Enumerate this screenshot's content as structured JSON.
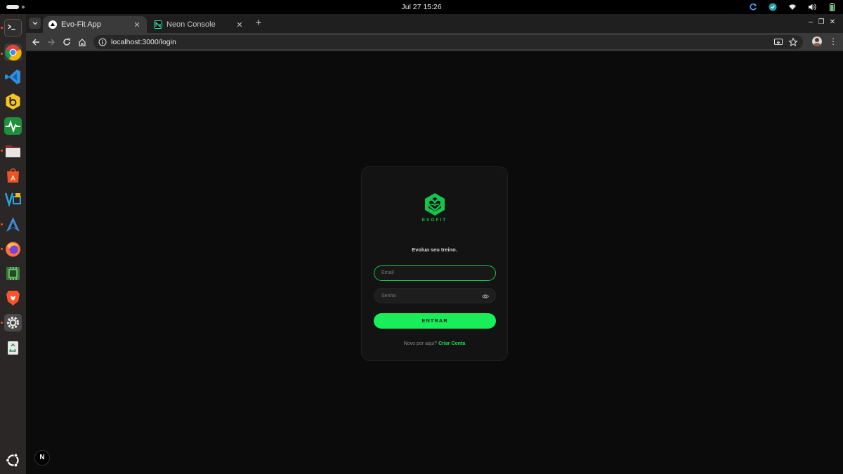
{
  "system": {
    "clock": "Jul 27  15:26"
  },
  "dock": {
    "apps": [
      {
        "name": "terminal",
        "indicator": true
      },
      {
        "name": "chrome",
        "indicator": true
      },
      {
        "name": "vscode",
        "indicator": false
      },
      {
        "name": "beekeeper",
        "indicator": false
      },
      {
        "name": "system-monitor",
        "indicator": false
      },
      {
        "name": "files",
        "indicator": true
      },
      {
        "name": "app-center",
        "indicator": false
      },
      {
        "name": "virtualbox",
        "indicator": false
      },
      {
        "name": "arch-app",
        "indicator": true
      },
      {
        "name": "firefox",
        "indicator": true
      },
      {
        "name": "chip-app",
        "indicator": false
      },
      {
        "name": "brave",
        "indicator": false
      },
      {
        "name": "settings",
        "indicator": true
      },
      {
        "name": "trash",
        "indicator": false
      },
      {
        "name": "ubuntu-show-apps",
        "indicator": false
      }
    ]
  },
  "browser": {
    "tabs": [
      {
        "title": "Evo-Fit App",
        "active": true,
        "close": "✕"
      },
      {
        "title": "Neon Console",
        "active": false,
        "close": "✕"
      }
    ],
    "new_tab": "+",
    "window_controls": [
      "–",
      "❐",
      "✕"
    ],
    "url": "localhost:3000/login",
    "menu": "⋮"
  },
  "login": {
    "brand": "EVOFIT",
    "tagline": "Evolua seu treino.",
    "email_placeholder": "Email",
    "password_placeholder": "Senha",
    "submit_label": "ENTRAR",
    "signup_prompt": "Novo por aqui?",
    "signup_link": "Criar Conta"
  },
  "dev": {
    "next_badge": "N"
  },
  "colors": {
    "accent": "#19ee5a",
    "brand_green": "#16c44d",
    "card_bg": "#131313",
    "page_bg": "#0b0b0b"
  }
}
